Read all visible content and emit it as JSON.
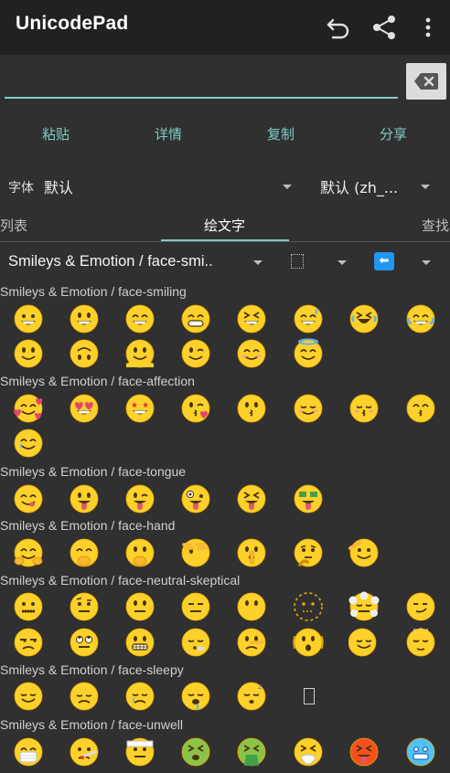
{
  "app": {
    "title": "UnicodePad"
  },
  "toolbar": {
    "undo_icon": "undo-icon",
    "share_icon": "share-icon",
    "more_icon": "more-vert-icon"
  },
  "input": {
    "value": "",
    "placeholder": ""
  },
  "actions": {
    "paste": "粘贴",
    "details": "详情",
    "copy": "复制",
    "share": "分享"
  },
  "font_row": {
    "label": "字体",
    "font_value": "默认",
    "locale_value": "默认 (zh_..."
  },
  "tabs": {
    "list": "列表",
    "emoji": "绘文字",
    "search": "查找"
  },
  "category": {
    "selected": "Smileys & Emotion / face-smi.."
  },
  "sections": [
    {
      "label": "Smileys & Emotion / face-smiling"
    },
    {
      "label": "Smileys & Emotion / face-affection"
    },
    {
      "label": "Smileys & Emotion / face-tongue"
    },
    {
      "label": "Smileys & Emotion / face-hand"
    },
    {
      "label": "Smileys & Emotion / face-neutral-skeptical"
    },
    {
      "label": "Smileys & Emotion / face-sleepy"
    },
    {
      "label": "Smileys & Emotion / face-unwell"
    }
  ],
  "emoji_rows": [
    [
      "grinning",
      "grinning-big-eyes",
      "grinning-smiling-eyes",
      "beaming",
      "squinting",
      "sweat-smile",
      "rofl",
      "tears-of-joy"
    ],
    [
      "slight-smile",
      "upside-down",
      "melting",
      "winking",
      "smiling-eyes",
      "halo"
    ],
    [
      "hearts",
      "heart-eyes",
      "star-struck",
      "blowing-kiss",
      "kissing",
      "relaxed",
      "kissing-closed-eyes",
      "kissing-smiling-eyes"
    ],
    [
      "smiling-tear"
    ],
    [
      "yum",
      "tongue",
      "winking-tongue",
      "zany",
      "squinting-tongue",
      "money-mouth"
    ],
    [
      "hugging",
      "hand-over-mouth",
      "open-eyes-hand",
      "peeking-eye",
      "shushing",
      "thinking",
      "saluting"
    ],
    [
      "zipper-mouth",
      "raised-eyebrow",
      "neutral",
      "expressionless",
      "no-mouth",
      "dotted-line",
      "face-in-clouds",
      "smirking"
    ],
    [
      "unamused",
      "eye-roll",
      "grimacing",
      "exhaling",
      "lying",
      "shaking",
      "head-shaking",
      "nodding"
    ],
    [
      "relieved",
      "pensive",
      "sleepy",
      "drooling",
      "sleeping",
      "placeholder"
    ],
    [
      "mask",
      "thermometer",
      "bandage",
      "nauseated",
      "vomiting",
      "sneezing",
      "hot",
      "cold"
    ]
  ]
}
